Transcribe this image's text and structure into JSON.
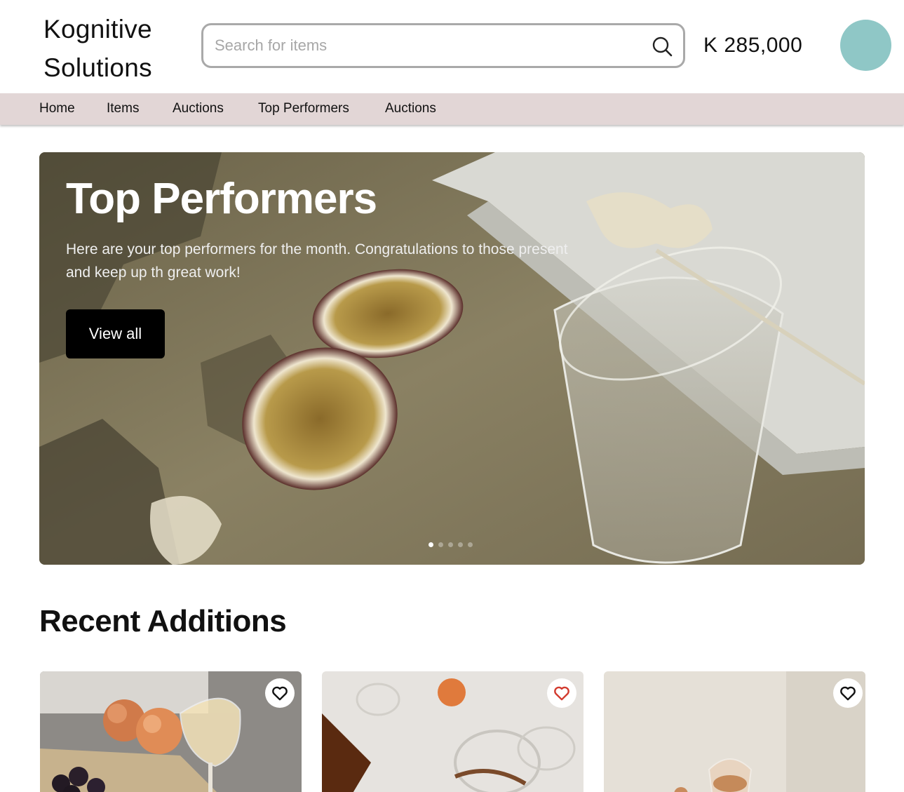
{
  "header": {
    "brand_line1": "Kognitive",
    "brand_line2": "Solutions",
    "search_placeholder": "Search for items",
    "search_icon": "search-icon",
    "balance": "K 285,000",
    "avatar_color": "#8fc7c6"
  },
  "nav": {
    "items": [
      "Home",
      "Items",
      "Auctions",
      "Top Performers",
      "Auctions"
    ],
    "background": "#e2d6d6"
  },
  "hero": {
    "title": "Top Performers",
    "description": "Here are your top performers for the month. Congratulations to those present and keep up th great work!",
    "button_label": "View all",
    "slides_count": 5,
    "active_slide": 1
  },
  "recent": {
    "title": "Recent Additions",
    "cards": [
      {
        "favorite_icon": "heart-outline-icon",
        "favorited": false
      },
      {
        "favorite_icon": "heart-outline-icon",
        "favorited": true,
        "icon_color": "#d23a2e"
      },
      {
        "favorite_icon": "heart-outline-icon",
        "favorited": false
      }
    ]
  }
}
